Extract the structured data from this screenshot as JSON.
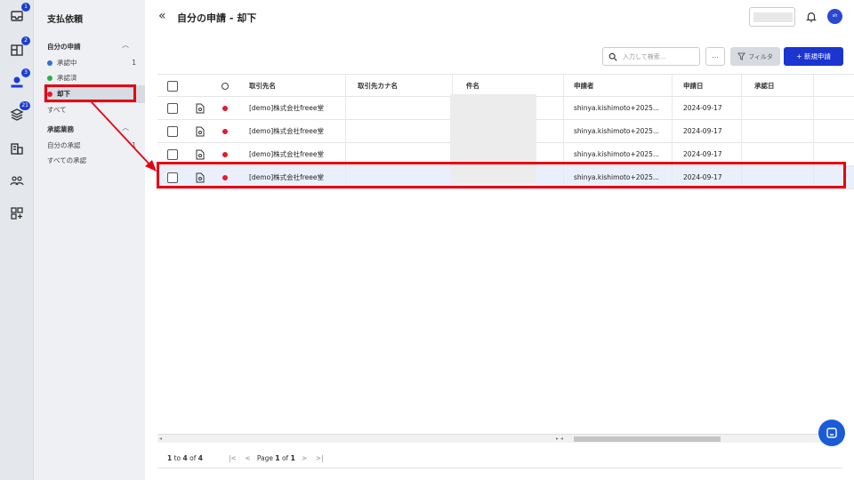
{
  "rail": {
    "items": [
      {
        "icon": "inbox-icon",
        "badge": "1"
      },
      {
        "icon": "grid-plus-icon",
        "badge": "2"
      },
      {
        "icon": "user-upload-icon",
        "badge": "3"
      },
      {
        "icon": "layers-icon",
        "badge": "21"
      },
      {
        "icon": "building-icon",
        "badge": ""
      },
      {
        "icon": "people-icon",
        "badge": ""
      },
      {
        "icon": "apps-icon",
        "badge": ""
      }
    ]
  },
  "sidebar": {
    "title": "支払依頼",
    "my_requests": {
      "label": "自分の申請",
      "items": [
        {
          "label": "承認中",
          "count": "1",
          "color": "#2f6fe0"
        },
        {
          "label": "承認済",
          "count": "",
          "color": "#2fae4a"
        },
        {
          "label": "却下",
          "count": "",
          "color": "#e6192e"
        },
        {
          "label": "すべて",
          "count": ""
        }
      ]
    },
    "approval": {
      "label": "承認業務",
      "items": [
        {
          "label": "自分の承認",
          "count": "1"
        },
        {
          "label": "すべての承認",
          "count": ""
        }
      ]
    }
  },
  "header": {
    "title": "自分の申請 - 却下",
    "avatar": "sh"
  },
  "toolbar": {
    "search_placeholder": "入力して検索...",
    "more_label": "...",
    "filter_label": "フィルタ",
    "new_label": "+ 新規申請"
  },
  "table": {
    "columns": [
      "取引先名",
      "取引先カナ名",
      "件名",
      "申請者",
      "申請日",
      "承認日"
    ],
    "rows": [
      {
        "partner": "[demo]株式会社freee堂",
        "kana": "",
        "subject": "",
        "applicant": "shinya.kishimoto+2025...",
        "date": "2024-09-17",
        "approved": ""
      },
      {
        "partner": "[demo]株式会社freee堂",
        "kana": "",
        "subject": "",
        "applicant": "shinya.kishimoto+2025...",
        "date": "2024-09-17",
        "approved": ""
      },
      {
        "partner": "[demo]株式会社freee堂",
        "kana": "",
        "subject": "",
        "applicant": "shinya.kishimoto+2025...",
        "date": "2024-09-17",
        "approved": ""
      },
      {
        "partner": "[demo]株式会社freee堂",
        "kana": "",
        "subject": "",
        "applicant": "shinya.kishimoto+2025...",
        "date": "2024-09-17",
        "approved": ""
      }
    ]
  },
  "footer": {
    "count_prefix": "1",
    "count_mid": " to ",
    "count_end": "4",
    "count_of": " of ",
    "count_total": "4",
    "page_label": "Page ",
    "page_current": "1",
    "page_of": " of ",
    "page_total": "1"
  },
  "colors": {
    "accent": "#1a35d0",
    "highlight": "#e60012",
    "rejected": "#e6192e"
  }
}
